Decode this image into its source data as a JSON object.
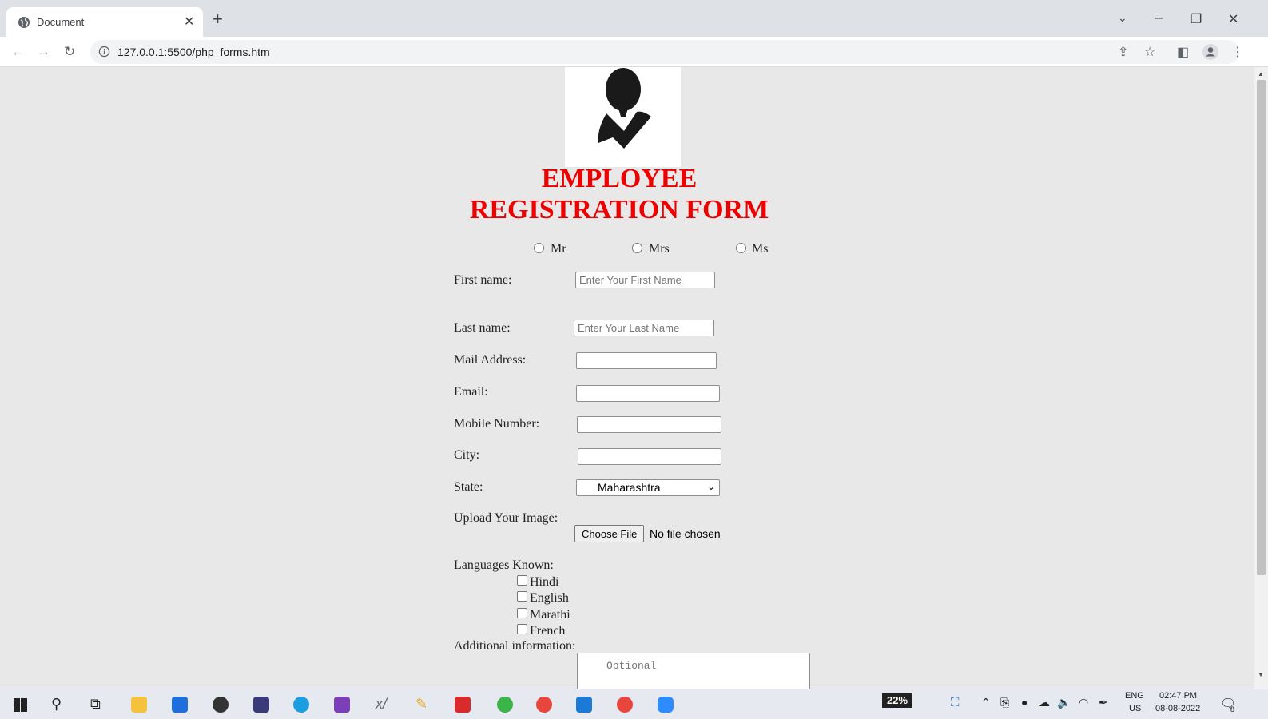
{
  "browser": {
    "tab_title": "Document",
    "url": "127.0.0.1:5500/php_forms.htm"
  },
  "form": {
    "title_line1": "EMPLOYEE",
    "title_line2": "REGISTRATION FORM",
    "titles": [
      "Mr",
      "Mrs",
      "Ms"
    ],
    "first_name_label": "First name:",
    "first_name_placeholder": "Enter Your First Name",
    "last_name_label": "Last name:",
    "last_name_placeholder": "Enter Your Last Name",
    "mail_address_label": "Mail Address:",
    "email_label": "Email:",
    "mobile_label": "Mobile Number:",
    "city_label": "City:",
    "state_label": "State:",
    "state_value": "Maharashtra",
    "upload_label": "Upload Your Image:",
    "choose_file_label": "Choose File",
    "no_file_text": "No file chosen",
    "languages_label": "Languages Known:",
    "languages": [
      "Hindi",
      "English",
      "Marathi",
      "French"
    ],
    "additional_label": "Additional information:",
    "additional_placeholder": "Optional"
  },
  "taskbar": {
    "battery": "22%",
    "lang_line1": "ENG",
    "lang_line2": "US",
    "time": "02:47 PM",
    "date": "08-08-2022",
    "notification_count": "8"
  },
  "colors": {
    "title_red": "#e00000",
    "page_bg": "#e8e8e8"
  }
}
